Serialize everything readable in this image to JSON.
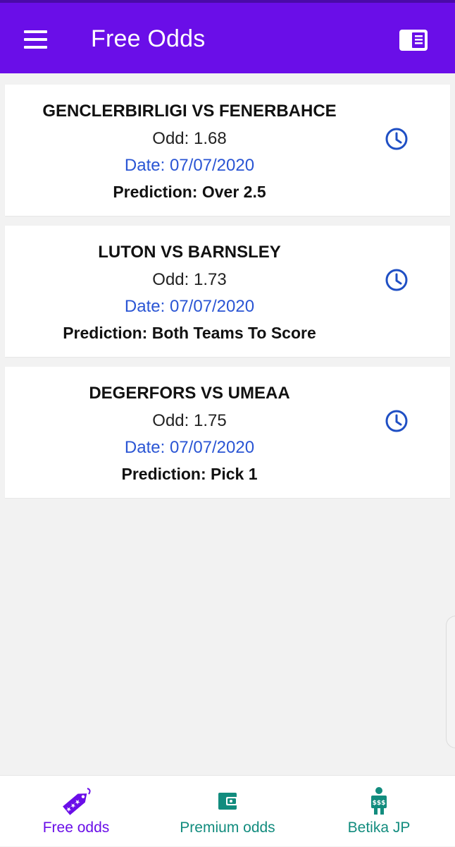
{
  "app": {
    "title": "Free Odds",
    "accent_color": "#6a0ee8",
    "teal_color": "#128c7e",
    "date_color": "#2a55d4"
  },
  "header": {
    "menu_icon": "hamburger-menu-icon",
    "right_icon": "reader-mode-icon"
  },
  "predictions": [
    {
      "match": "GENCLERBIRLIGI VS FENERBAHCE",
      "odd": "Odd: 1.68",
      "date": "Date: 07/07/2020",
      "prediction": "Prediction: Over 2.5",
      "icon": "clock-icon"
    },
    {
      "match": "LUTON VS BARNSLEY",
      "odd": "Odd: 1.73",
      "date": "Date: 07/07/2020",
      "prediction": "Prediction: Both Teams To Score",
      "icon": "clock-icon"
    },
    {
      "match": "DEGERFORS VS UMEAA",
      "odd": "Odd: 1.75",
      "date": "Date: 07/07/2020",
      "prediction": "Prediction: Pick 1",
      "icon": "clock-icon"
    }
  ],
  "bottom_nav": {
    "items": [
      {
        "label": "Free odds",
        "icon": "ticket-tag-icon",
        "active": true
      },
      {
        "label": "Premium odds",
        "icon": "wallet-icon",
        "active": false
      },
      {
        "label": "Betika JP",
        "icon": "money-person-icon",
        "active": false
      }
    ]
  }
}
